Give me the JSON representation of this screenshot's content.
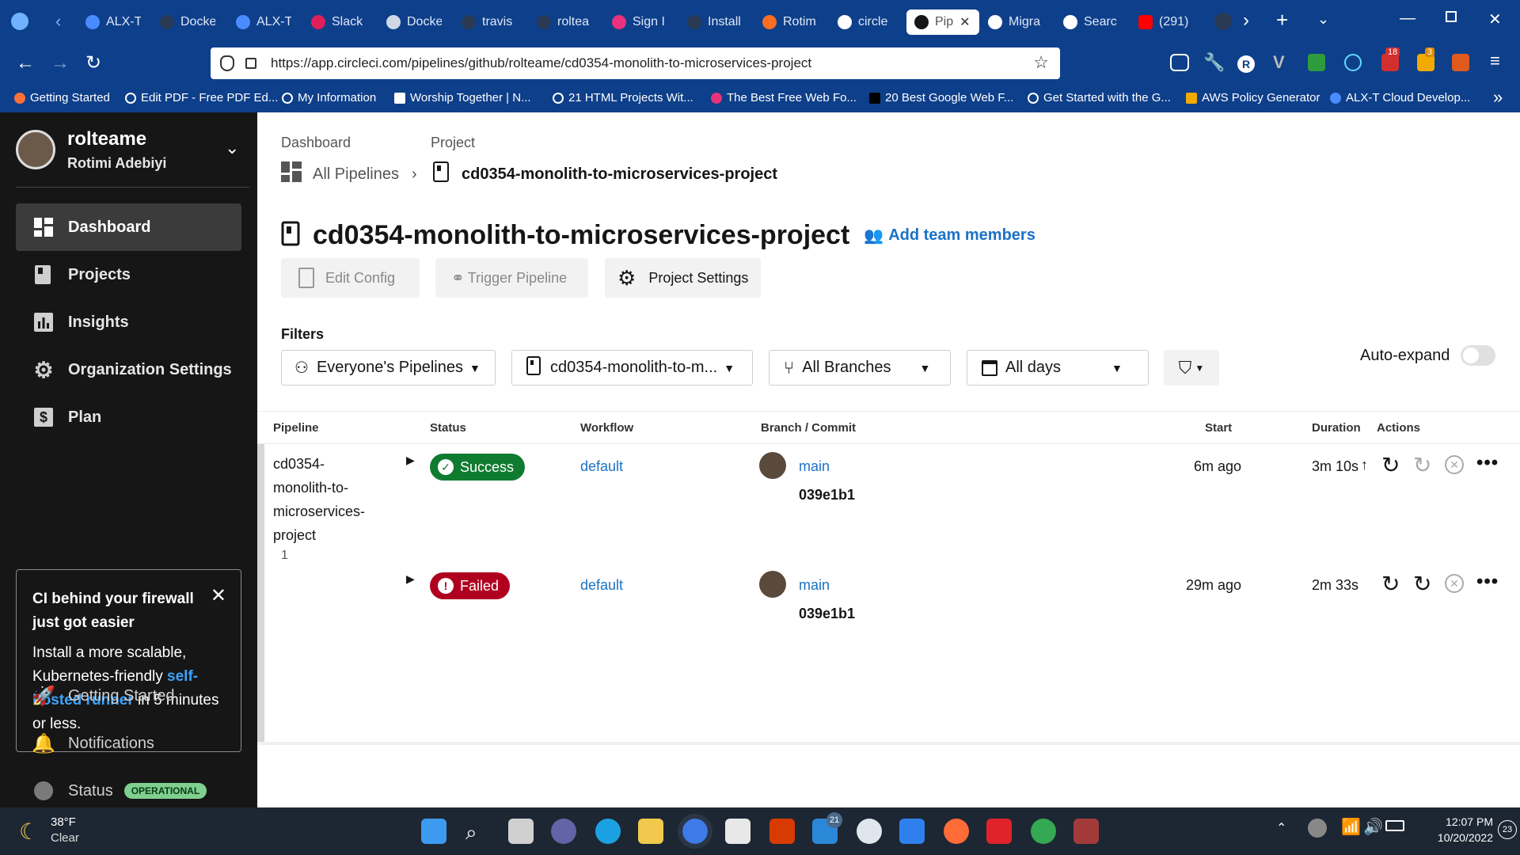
{
  "browser": {
    "tabs": [
      {
        "label": "ALX-T",
        "color": "#4a8cff"
      },
      {
        "label": "Docke",
        "color": "#2a3a55"
      },
      {
        "label": "ALX-T",
        "color": "#4a8cff"
      },
      {
        "label": "Slack",
        "color": "#e01e5a"
      },
      {
        "label": "Docke",
        "color": "#cfd8e6"
      },
      {
        "label": "travis",
        "color": "#2a3a55"
      },
      {
        "label": "roltea",
        "color": "#2a3a55"
      },
      {
        "label": "Sign I",
        "color": "#e8327c"
      },
      {
        "label": "Install",
        "color": "#2a3a55"
      },
      {
        "label": "Rotim",
        "color": "#fc6d26"
      },
      {
        "label": "circle",
        "color": "#ffffff"
      },
      {
        "label": "Pip",
        "color": "#161616"
      },
      {
        "label": "Migra",
        "color": "#ffffff"
      },
      {
        "label": "Searc",
        "color": "#ffffff"
      },
      {
        "label": "(291)",
        "color": "#ff0000"
      }
    ],
    "url": "https://app.circleci.com/pipelines/github/rolteame/cd0354-monolith-to-microservices-project",
    "bookmarks": [
      "Getting Started",
      "Edit PDF - Free PDF Ed...",
      "My Information",
      "Worship Together | N...",
      "21 HTML Projects Wit...",
      "The Best Free Web Fo...",
      "20 Best Google Web F...",
      "Get Started with the G...",
      "AWS Policy Generator",
      "ALX-T Cloud Develop..."
    ],
    "ext_badges": {
      "mail": "18",
      "ext": "3"
    }
  },
  "sidebar": {
    "org_name": "rolteame",
    "user_name": "Rotimi Adebiyi",
    "nav": [
      "Dashboard",
      "Projects",
      "Insights",
      "Organization Settings",
      "Plan"
    ],
    "promo": {
      "title": "CI behind your firewall just got easier",
      "body_start": "Install a more scalable, Kubernetes-friendly ",
      "link": "self-hosted runner",
      "body_end": " in 5 minutes or less."
    },
    "bottom": [
      "Getting Started",
      "Notifications",
      "Status"
    ],
    "status_badge": "OPERATIONAL"
  },
  "main": {
    "breadcrumb": {
      "dashboard_label": "Dashboard",
      "project_label": "Project",
      "all_pipelines": "All Pipelines",
      "project": "cd0354-monolith-to-microservices-project"
    },
    "title": "cd0354-monolith-to-microservices-project",
    "add_team": "Add team members",
    "buttons": {
      "edit_config": "Edit Config",
      "trigger": "Trigger Pipeline",
      "settings": "Project Settings"
    },
    "filters_label": "Filters",
    "filters": {
      "pipelines": "Everyone's Pipelines",
      "project": "cd0354-monolith-to-m...",
      "branches": "All Branches",
      "days": "All days"
    },
    "auto_expand": "Auto-expand",
    "table": {
      "headers": [
        "Pipeline",
        "Status",
        "Workflow",
        "Branch / Commit",
        "Start",
        "Duration",
        "Actions"
      ],
      "pipeline_name_lines": [
        "cd0354-",
        "monolith-to-",
        "microservices-",
        "project"
      ],
      "pipeline_number": "1",
      "rows": [
        {
          "status": "Success",
          "status_color": "#0f7b2f",
          "workflow": "default",
          "branch": "main",
          "commit": "039e1b1",
          "start": "6m ago",
          "duration": "3m 10s"
        },
        {
          "status": "Failed",
          "status_color": "#b00020",
          "workflow": "default",
          "branch": "main",
          "commit": "039e1b1",
          "start": "29m ago",
          "duration": "2m 33s"
        }
      ]
    }
  },
  "taskbar": {
    "weather_temp": "38°F",
    "weather_desc": "Clear",
    "time": "12:07 PM",
    "date": "10/20/2022",
    "notif_count": "23",
    "mail_count": "21"
  }
}
